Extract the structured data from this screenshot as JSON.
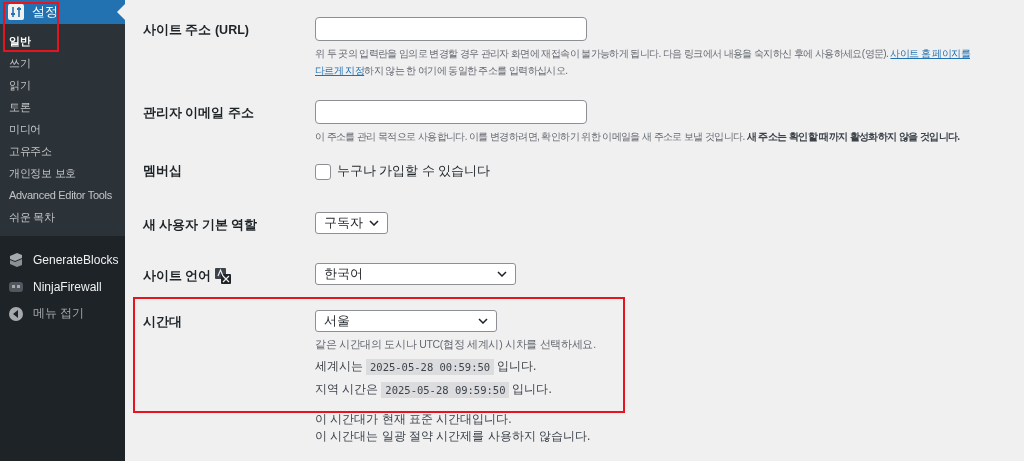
{
  "sidebar": {
    "current": {
      "label": "설정",
      "highlighted": true
    },
    "items": [
      {
        "label": "일반",
        "selected": true
      },
      {
        "label": "쓰기",
        "selected": false
      },
      {
        "label": "읽기",
        "selected": false
      },
      {
        "label": "토론",
        "selected": false
      },
      {
        "label": "미디어",
        "selected": false
      },
      {
        "label": "고유주소",
        "selected": false
      },
      {
        "label": "개인정보 보호",
        "selected": false
      },
      {
        "label": "Advanced Editor Tools",
        "selected": false
      },
      {
        "label": "쉬운 목차",
        "selected": false
      }
    ],
    "plugins": [
      {
        "label": "GenerateBlocks",
        "kind": "blocks"
      },
      {
        "label": "NinjaFirewall",
        "kind": "firewall"
      },
      {
        "label": "메뉴 접기",
        "kind": "collapse"
      }
    ]
  },
  "settings": [
    {
      "kind": "text",
      "label": "사이트 주소 (URL)",
      "lines": [
        [
          {
            "text": "위 두 곳의 입력란을 임의로 변경할 경우 관리자 화면에 재접속이 불가능하게 됩니다. 다음 링크에서 내용을 숙지하신 후에 사용하세요(영문). "
          },
          {
            "text": "사이트 홈 페이지를",
            "link": true
          }
        ],
        [
          {
            "text": "다르게 지정",
            "link": true
          },
          {
            "text": "하지 않는 한 여기에 동일한 주소를 입력하십시오."
          }
        ]
      ]
    },
    {
      "kind": "text",
      "label": "관리자 이메일 주소",
      "lines": [
        [
          {
            "text": "이 주소를 관리 목적으로 사용합니다. 이를 변경하려면, 확인하기 위한 이메일을 새 주소로 보낼 것입니다. **새 주소는 확인할 때까지 활성화하지 않을 것입니다.**"
          }
        ]
      ]
    },
    {
      "kind": "checkbox",
      "label": "멤버십",
      "option": "누구나 가입할 수 있습니다",
      "checked": false
    },
    {
      "kind": "select",
      "label": "새 사용자 기본 역할",
      "value": "구독자"
    },
    {
      "kind": "wide_select",
      "label": "사이트 언어",
      "value": "한국어",
      "translate_icon": true
    },
    {
      "kind": "timezone",
      "label": "시간대",
      "value": "서울",
      "highlighted": true,
      "hint": "같은 시간대의 도시나 UTC(협정 세계시) 시차를 선택하세요.",
      "times": [
        {
          "before": "세계시는",
          "time": "2025-05-28 00:59:50",
          "after": "입니다."
        },
        {
          "before": "지역 시간은",
          "time": "2025-05-28 09:59:50",
          "after": "입니다."
        }
      ],
      "notes": [
        "이 시간대가 현재 표준 시간대입니다.",
        "이 시간대는 일광 절약 시간제를 사용하지 않습니다."
      ]
    }
  ]
}
